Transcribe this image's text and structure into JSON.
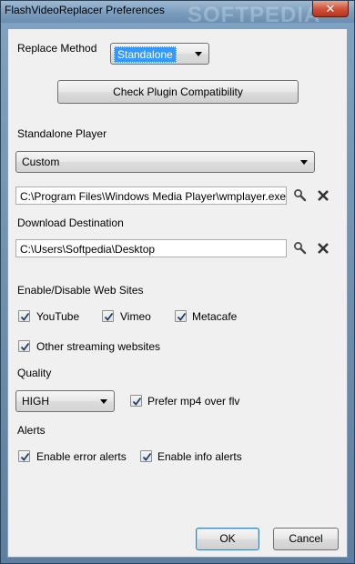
{
  "window": {
    "title": "FlashVideoReplacer Preferences",
    "close_label": "✕",
    "watermark": "SOFTPEDIA"
  },
  "replace_method": {
    "label": "Replace Method",
    "selected": "Standalone"
  },
  "check_plugin_button": "Check Plugin Compatibility",
  "standalone_player": {
    "label": "Standalone Player",
    "selected": "Custom",
    "path": "C:\\Program Files\\Windows Media Player\\wmplayer.exe"
  },
  "download_destination": {
    "label": "Download Destination",
    "path": "C:\\Users\\Softpedia\\Desktop"
  },
  "websites": {
    "label": "Enable/Disable Web Sites",
    "youtube": "YouTube",
    "vimeo": "Vimeo",
    "metacafe": "Metacafe",
    "other": "Other streaming websites",
    "youtube_checked": true,
    "vimeo_checked": true,
    "metacafe_checked": true,
    "other_checked": true
  },
  "quality": {
    "label": "Quality",
    "selected": "HIGH",
    "prefer_mp4": "Prefer mp4 over flv",
    "prefer_mp4_checked": true
  },
  "alerts": {
    "label": "Alerts",
    "error": "Enable error alerts",
    "info": "Enable info alerts",
    "error_checked": true,
    "info_checked": true
  },
  "buttons": {
    "ok": "OK",
    "cancel": "Cancel"
  },
  "icons": {
    "browse": "magnifier-icon",
    "clear": "x-icon"
  }
}
